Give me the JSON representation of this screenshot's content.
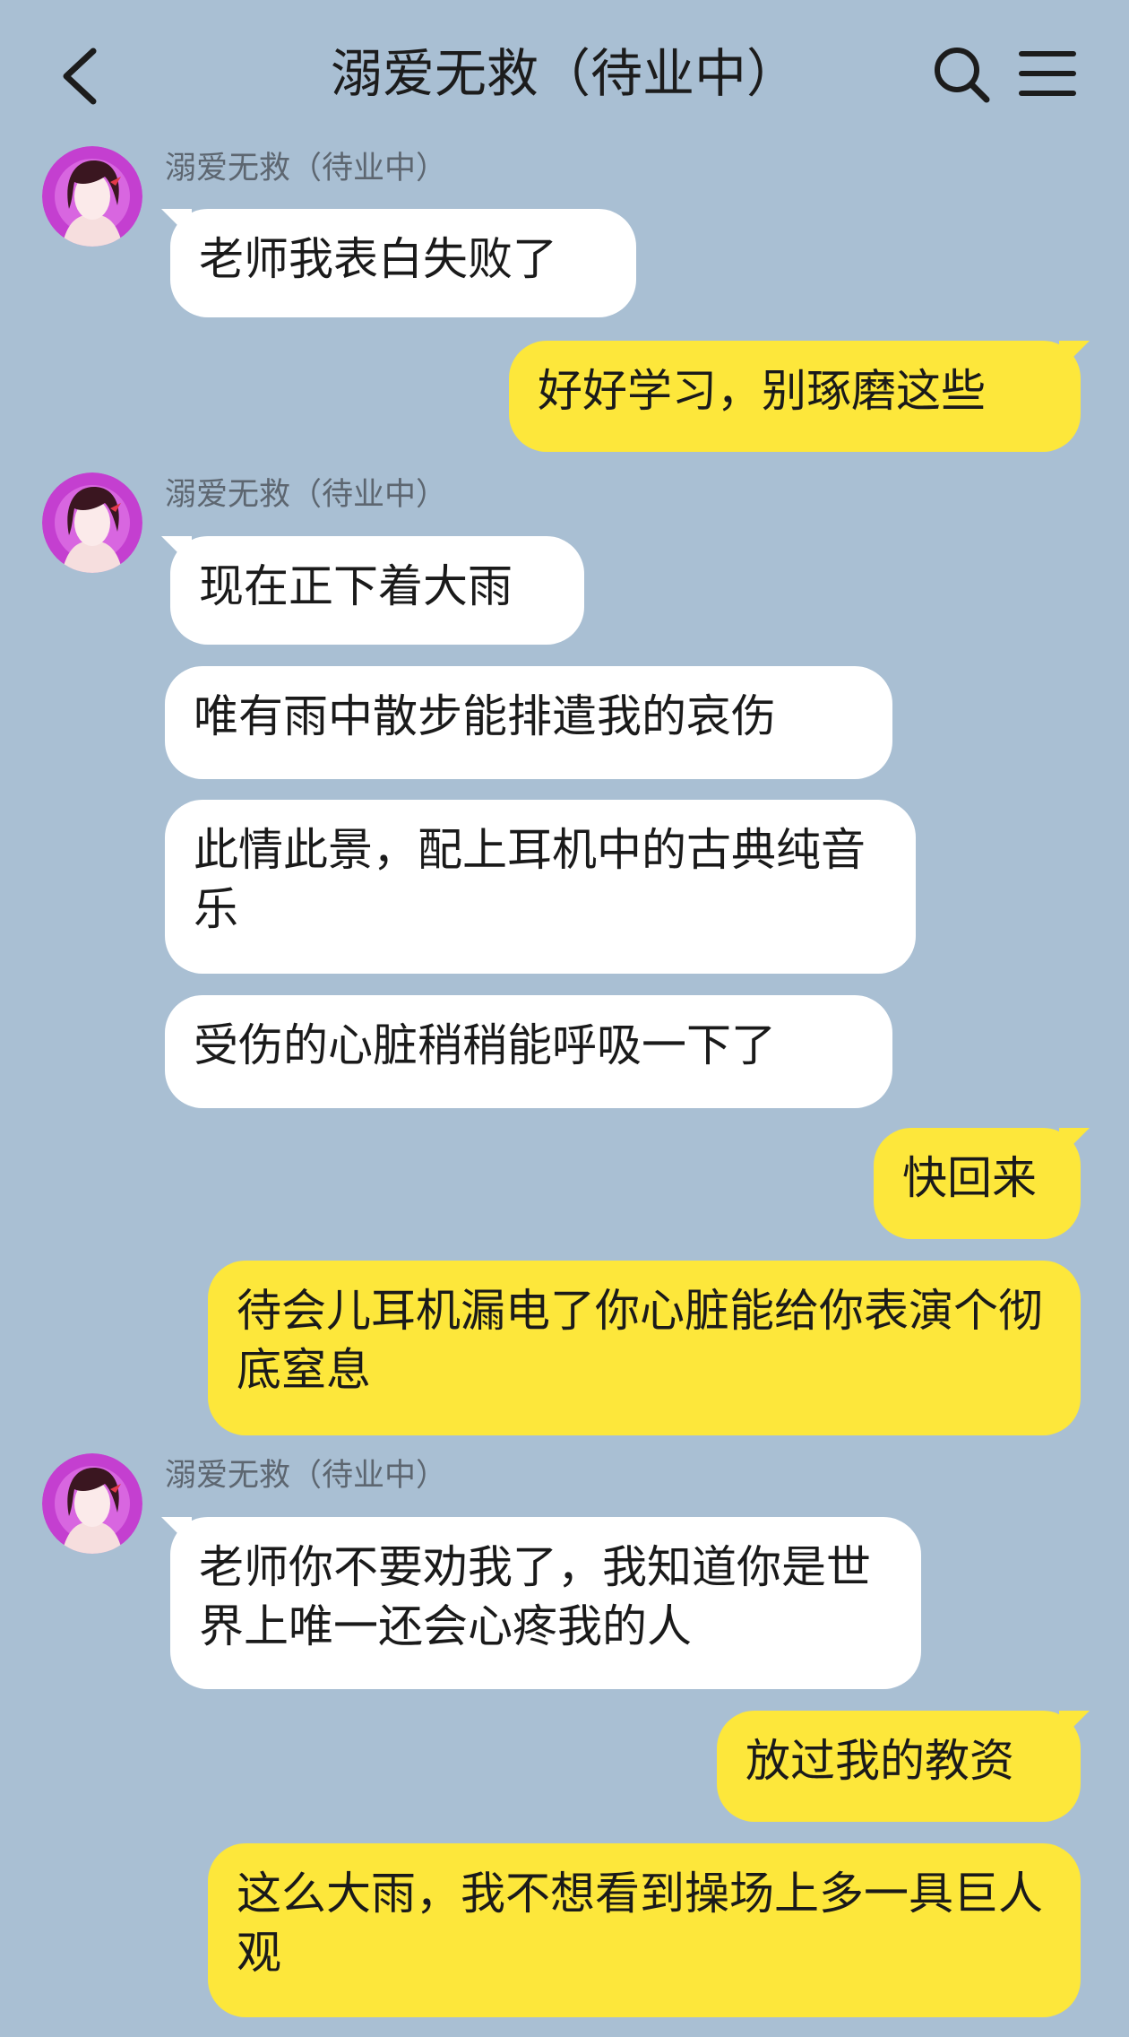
{
  "header": {
    "title": "溺爱无救（待业中）",
    "back_icon": "chevron-left-icon",
    "search_icon": "search-icon",
    "menu_icon": "hamburger-menu-icon"
  },
  "colors": {
    "background": "#a9bfd3",
    "incoming_bubble": "#ffffff",
    "outgoing_bubble": "#fde73b",
    "avatar_ring": "#c43fd0"
  },
  "sender_name": "溺爱无救（待业中）",
  "messages": [
    {
      "side": "incoming",
      "text": "老师我表白失败了"
    },
    {
      "side": "outgoing",
      "text": "好好学习，别琢磨这些"
    },
    {
      "side": "incoming",
      "text": "现在正下着大雨"
    },
    {
      "side": "incoming",
      "text": "唯有雨中散步能排遣我的哀伤"
    },
    {
      "side": "incoming",
      "text": "此情此景，配上耳机中的古典纯音乐"
    },
    {
      "side": "incoming",
      "text": "受伤的心脏稍稍能呼吸一下了"
    },
    {
      "side": "outgoing",
      "text": "快回来"
    },
    {
      "side": "outgoing",
      "text": "待会儿耳机漏电了你心脏能给你表演个彻底窒息"
    },
    {
      "side": "incoming",
      "text": "老师你不要劝我了，我知道你是世界上唯一还会心疼我的人"
    },
    {
      "side": "outgoing",
      "text": "放过我的教资"
    },
    {
      "side": "outgoing",
      "text": "这么大雨，我不想看到操场上多一具巨人观"
    }
  ]
}
